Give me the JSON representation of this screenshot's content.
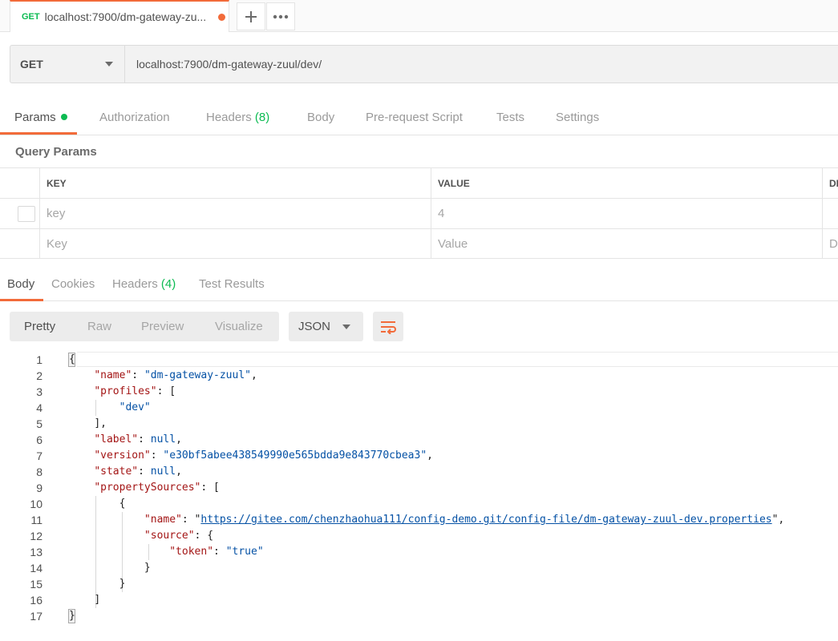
{
  "tab": {
    "method": "GET",
    "title": "localhost:7900/dm-gateway-zu..."
  },
  "request": {
    "method": "GET",
    "url": "localhost:7900/dm-gateway-zuul/dev/"
  },
  "request_tabs": {
    "params": "Params",
    "authorization": "Authorization",
    "headers": "Headers",
    "headers_count": "(8)",
    "body": "Body",
    "prerequest": "Pre-request Script",
    "tests": "Tests",
    "settings": "Settings"
  },
  "query_params": {
    "title": "Query Params",
    "headers": {
      "key": "KEY",
      "value": "VALUE",
      "description": "DE"
    },
    "rows": [
      {
        "key": "key",
        "value": "4"
      }
    ],
    "placeholder": {
      "key": "Key",
      "value": "Value",
      "description": "D"
    }
  },
  "response_tabs": {
    "body": "Body",
    "cookies": "Cookies",
    "headers": "Headers",
    "headers_count": "(4)",
    "test_results": "Test Results"
  },
  "view_modes": {
    "pretty": "Pretty",
    "raw": "Raw",
    "preview": "Preview",
    "visualize": "Visualize"
  },
  "format": "JSON",
  "code": {
    "line_numbers": [
      "1",
      "2",
      "3",
      "4",
      "5",
      "6",
      "7",
      "8",
      "9",
      "10",
      "11",
      "12",
      "13",
      "14",
      "15",
      "16",
      "17"
    ],
    "l1_open": "{",
    "l2_key": "\"name\"",
    "l2_val": "\"dm-gateway-zuul\"",
    "l3_key": "\"profiles\"",
    "l3_open": "[",
    "l4_val": "\"dev\"",
    "l5_close": "],",
    "l6_key": "\"label\"",
    "l6_val": "null",
    "l7_key": "\"version\"",
    "l7_val": "\"e30bf5abee438549990e565bdda9e843770cbea3\"",
    "l8_key": "\"state\"",
    "l8_val": "null",
    "l9_key": "\"propertySources\"",
    "l9_open": "[",
    "l10_open": "{",
    "l11_key": "\"name\"",
    "l11_url": "https://gitee.com/chenzhaohua111/config-demo.git/config-file/dm-gateway-zuul-dev.properties",
    "l12_key": "\"source\"",
    "l12_open": "{",
    "l13_key": "\"token\"",
    "l13_val": "\"true\"",
    "l14_close": "}",
    "l15_close": "}",
    "l16_close": "]",
    "l17_close": "}"
  }
}
